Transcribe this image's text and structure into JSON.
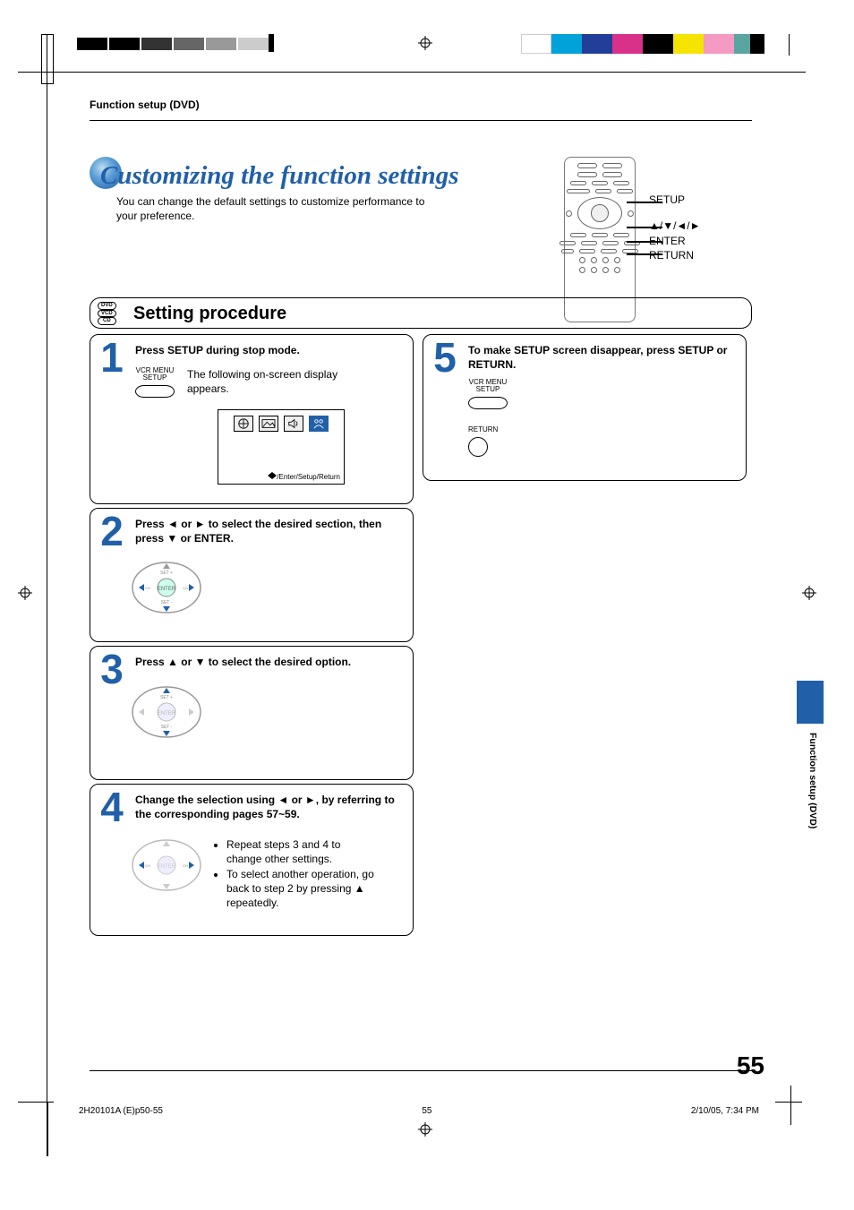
{
  "breadcrumb": "Function setup (DVD)",
  "hero": {
    "title": "Customizing the function settings",
    "desc": "You can change the default settings to customize performance to your preference."
  },
  "remote_labels": {
    "setup": "SETUP",
    "arrows": "▲/▼/◄/►",
    "enter": "ENTER",
    "return": "RETURN"
  },
  "disc_badges": [
    "DVD",
    "VCD",
    "CD"
  ],
  "procedure_title": "Setting procedure",
  "steps": [
    {
      "num": "1",
      "head": "Press SETUP during stop mode.",
      "btn_label_1": "VCR MENU",
      "btn_label_2": "SETUP",
      "body": "The following on-screen display appears.",
      "screen_footer": "/Enter/Setup/Return"
    },
    {
      "num": "2",
      "head": "Press ◄ or ► to select the desired section, then press ▼ or ENTER."
    },
    {
      "num": "3",
      "head": "Press ▲ or ▼ to select the desired option."
    },
    {
      "num": "4",
      "head": "Change the selection using ◄ or ►, by referring to the corresponding pages 57~59.",
      "note1": "Repeat steps 3 and 4 to change other settings.",
      "note2": "To select another operation, go back to step 2 by pressing ▲ repeatedly."
    },
    {
      "num": "5",
      "head": "To make SETUP screen disappear, press SETUP or RETURN.",
      "btn_label_1": "VCR MENU",
      "btn_label_2": "SETUP",
      "return_label": "RETURN"
    }
  ],
  "side_tab": "Function setup  (DVD)",
  "page_number": "55",
  "footer": {
    "left": "2H20101A (E)p50-55",
    "center": "55",
    "right": "2/10/05, 7:34 PM"
  },
  "colors": {
    "cyan": "#00a3d9",
    "blue": "#233e99",
    "magenta": "#d9308a",
    "yellow": "#f4e400",
    "green": "#6fbf3f",
    "pink": "#f59ac2",
    "teal": "#5aa5a0"
  }
}
